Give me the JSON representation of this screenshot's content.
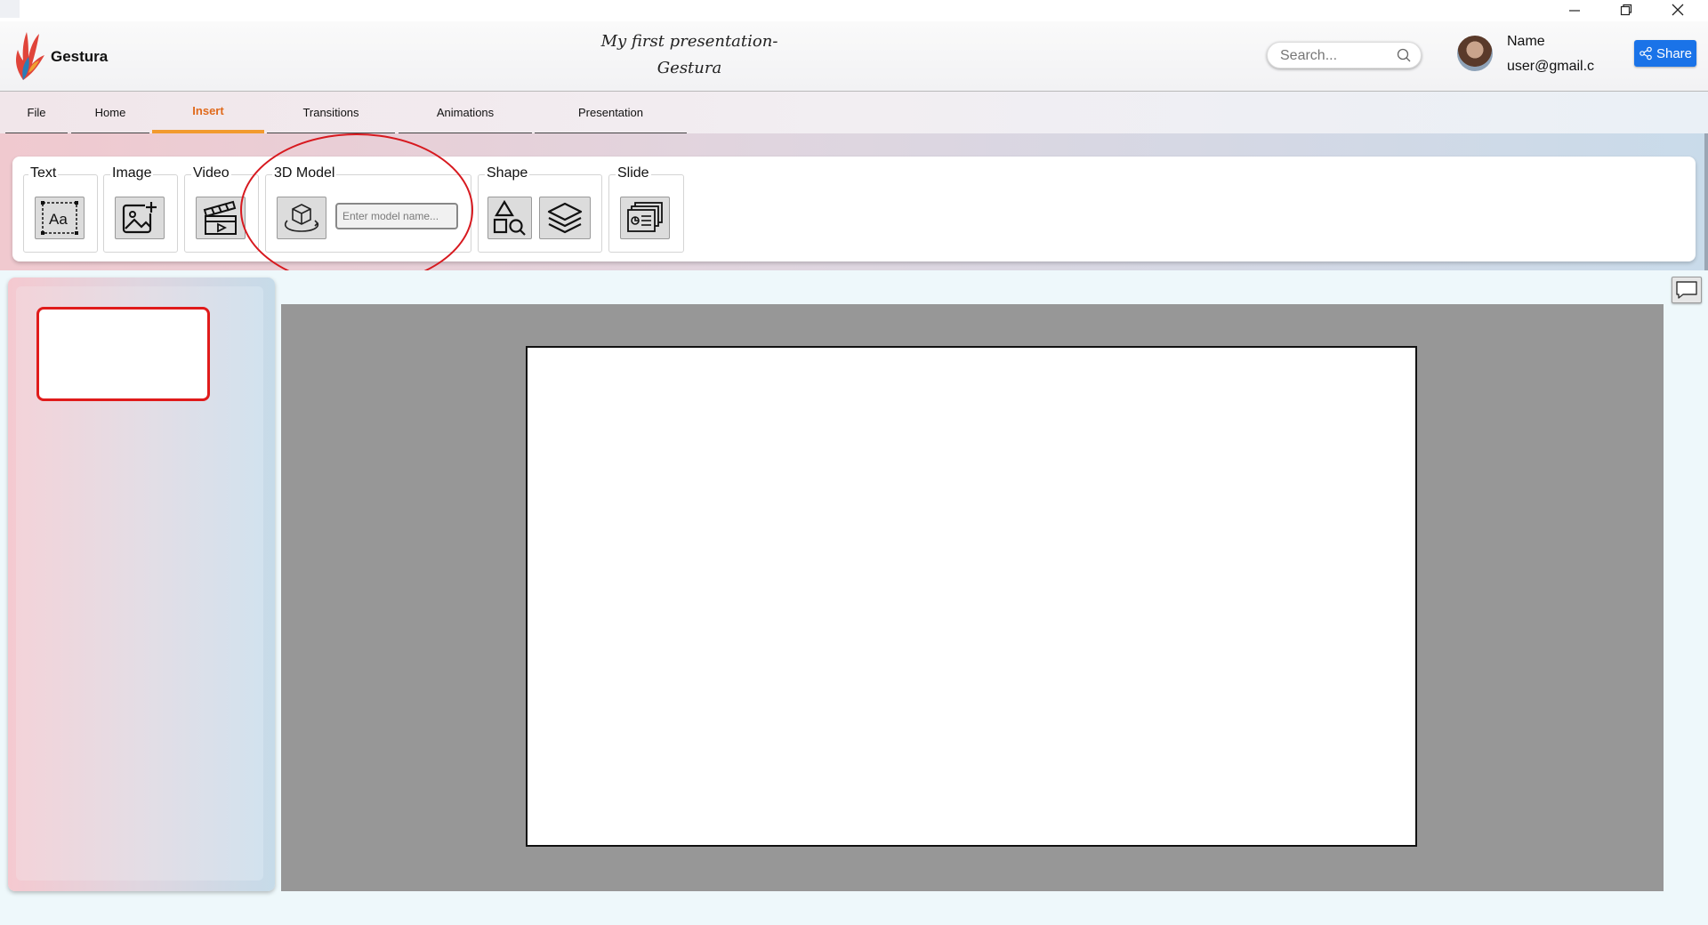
{
  "window": {
    "controls": [
      "minimize-icon",
      "restore-icon",
      "close-icon"
    ]
  },
  "header": {
    "app_name": "Gestura",
    "doc_title_line1": "My first presentation-",
    "doc_title_line2": "Gestura",
    "search": {
      "placeholder": "Search...",
      "icon": "search-icon"
    },
    "user": {
      "name": "Name",
      "email": "user@gmail.c"
    },
    "share_label": "Share",
    "share_icon": "share-icon",
    "accent_color": "#1a73e8"
  },
  "tabs": [
    {
      "label": "File",
      "active": false
    },
    {
      "label": "Home",
      "active": false
    },
    {
      "label": "Insert",
      "active": true
    },
    {
      "label": "Transitions",
      "active": false
    },
    {
      "label": "Animations",
      "active": false
    },
    {
      "label": "Presentation",
      "active": false
    }
  ],
  "active_tab_color": "#e06a1c",
  "ribbon": {
    "groups": [
      {
        "label": "Text",
        "icons": [
          "text-box-icon"
        ]
      },
      {
        "label": "Image",
        "icons": [
          "add-image-icon"
        ]
      },
      {
        "label": "Video",
        "icons": [
          "video-clapper-icon"
        ]
      },
      {
        "label": "3D Model",
        "icons": [
          "3d-cube-icon"
        ],
        "input_placeholder": "Enter model name..."
      },
      {
        "label": "Shape",
        "icons": [
          "shapes-icon",
          "layers-icon"
        ]
      },
      {
        "label": "Slide",
        "icons": [
          "new-slide-icon"
        ]
      }
    ]
  },
  "annotation": {
    "color": "#d7191f",
    "shape": "ellipse around 3D Model group"
  },
  "slides_panel": {
    "selected_thumb_border": "#e01b1b"
  },
  "comment_icon": "comment-icon"
}
